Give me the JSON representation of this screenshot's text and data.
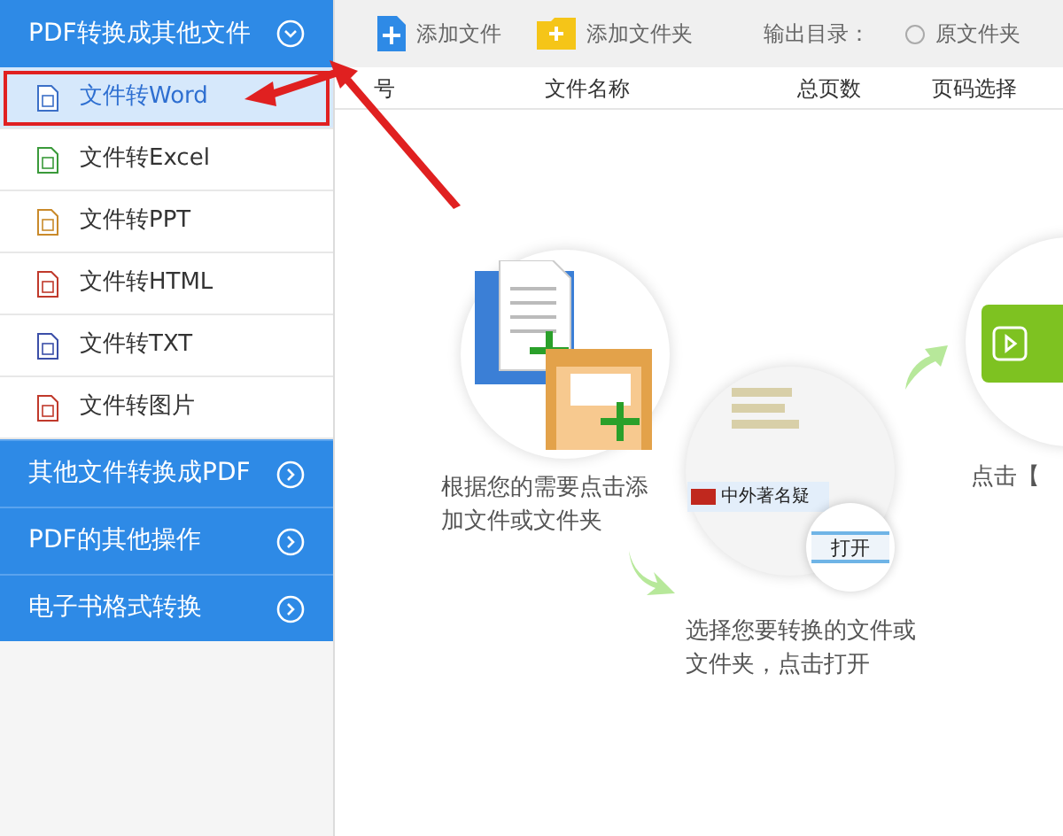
{
  "sidebar": {
    "sections": [
      {
        "label": "PDF转换成其他文件",
        "expanded": true,
        "items": [
          {
            "label": "文件转Word",
            "kind": "word",
            "selected": true
          },
          {
            "label": "文件转Excel",
            "kind": "excel",
            "selected": false
          },
          {
            "label": "文件转PPT",
            "kind": "ppt",
            "selected": false
          },
          {
            "label": "文件转HTML",
            "kind": "html",
            "selected": false
          },
          {
            "label": "文件转TXT",
            "kind": "txt",
            "selected": false
          },
          {
            "label": "文件转图片",
            "kind": "image",
            "selected": false
          }
        ]
      },
      {
        "label": "其他文件转换成PDF",
        "expanded": false
      },
      {
        "label": "PDF的其他操作",
        "expanded": false
      },
      {
        "label": "电子书格式转换",
        "expanded": false
      }
    ]
  },
  "toolbar": {
    "buttons": [
      {
        "label": "添加文件",
        "kind": "file"
      },
      {
        "label": "添加文件夹",
        "kind": "folder"
      }
    ],
    "output_label": "输出目录：",
    "output_option": {
      "label": "原文件夹",
      "selected": false
    }
  },
  "table": {
    "columns": [
      "号",
      "文件名称",
      "总页数",
      "页码选择"
    ]
  },
  "steps": [
    {
      "caption": "根据您的需要点击添加文件或文件夹"
    },
    {
      "caption": "选择您要转换的文件或文件夹，点击打开",
      "file_name": "中外著名疑",
      "button": "打开"
    },
    {
      "caption": "点击【"
    }
  ],
  "annotation": {
    "highlight_selected": true
  }
}
